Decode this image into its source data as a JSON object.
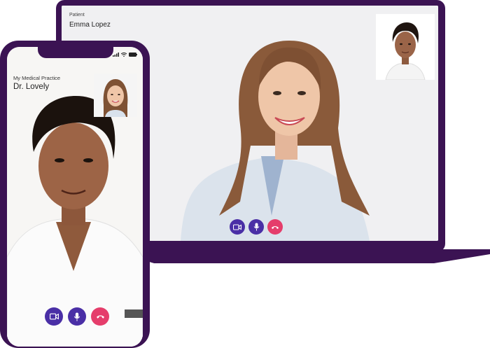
{
  "laptop": {
    "patient_label": "Patient",
    "patient_name": "Emma Lopez",
    "controls": [
      {
        "icon": "video-camera-icon",
        "color": "#4a2fa6"
      },
      {
        "icon": "microphone-icon",
        "color": "#4a2fa6"
      },
      {
        "icon": "end-call-icon",
        "color": "#e53d6b"
      }
    ]
  },
  "phone": {
    "practice_name": "My Medical Practice",
    "doctor_name": "Dr. Lovely",
    "controls": [
      {
        "icon": "video-camera-icon",
        "color": "#4a2fa6"
      },
      {
        "icon": "microphone-icon",
        "color": "#4a2fa6"
      },
      {
        "icon": "end-call-icon",
        "color": "#e53d6b"
      }
    ]
  },
  "colors": {
    "device_frame": "#3b1353",
    "control_primary": "#4a2fa6",
    "control_danger": "#e53d6b"
  }
}
